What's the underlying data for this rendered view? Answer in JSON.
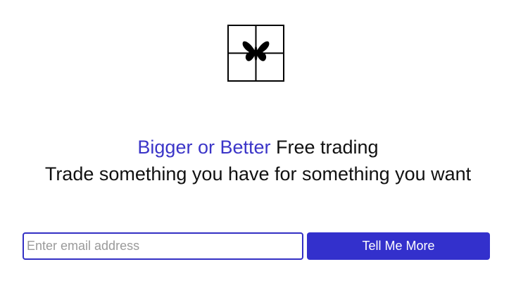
{
  "logo": {
    "icon": "gift-box-butterfly-icon"
  },
  "headline": {
    "brand": "Bigger or Better",
    "rest": " Free trading"
  },
  "tagline": "Trade something you have for something you want",
  "signup": {
    "email_placeholder": "Enter email address",
    "email_value": "",
    "button_label": "Tell Me More"
  },
  "colors": {
    "accent": "#3330cc",
    "brand_text": "#3b35c8",
    "text": "#111111",
    "placeholder": "#9a9a9a",
    "background": "#ffffff"
  }
}
